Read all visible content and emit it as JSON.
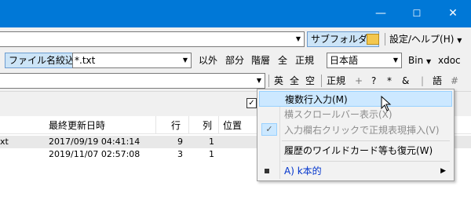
{
  "window": {
    "minimize": "—",
    "maximize": "☐",
    "close": "✕"
  },
  "toolbar1": {
    "subfolder": "サブフォルダ",
    "settings": "設定/ヘルプ(H)"
  },
  "toolbar2": {
    "filter_label": "ファイル名絞込:",
    "filter_value": "*.txt",
    "exclude": "以外",
    "partial": "部分",
    "hierarchy": "階層",
    "all": "全",
    "regex": "正規",
    "encoding": "日本語",
    "bin": "Bin",
    "xdoc": "xdoc"
  },
  "toolbar3": {
    "ei": "英",
    "zen": "全",
    "sora": "空",
    "seiki": "正規",
    "plus": "+",
    "q": "?",
    "star": "*",
    "amp": "&",
    "bar": "|",
    "go": "語",
    "hash": "#"
  },
  "grid": {
    "columns": [
      "最終更新日時",
      "行",
      "列",
      "位置"
    ],
    "rows": [
      {
        "name": "xt",
        "date": "2017/09/19 04:41:14",
        "line": "9",
        "col": "1"
      },
      {
        "name": "",
        "date": "2019/11/07 02:57:08",
        "line": "3",
        "col": "1"
      }
    ]
  },
  "menu": {
    "items": [
      {
        "label": "複数行入力(M)"
      },
      {
        "label": "横スクロールバー表示(X)"
      },
      {
        "label": "入力欄右クリックで正規表現挿入(V)"
      },
      {
        "label": "履歴のワイルドカード等も復元(W)"
      },
      {
        "label": "A) k本的"
      }
    ]
  }
}
